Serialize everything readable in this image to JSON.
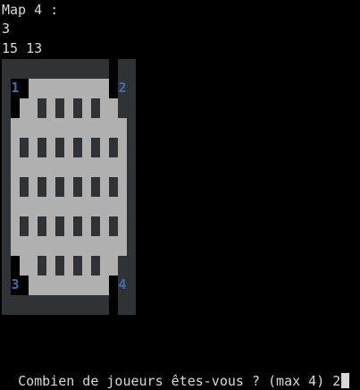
{
  "terminal": {
    "map_heading": "Map 4 :",
    "player_count_line": "3",
    "dimensions_line": "15 13",
    "prompt": "Combien de joueurs êtes-vous ? (max 4) 2"
  },
  "map": {
    "rows": 15,
    "cols": 13,
    "legend": {
      "#": "wall",
      ".": "floor",
      "X": "pillar",
      " ": "void",
      "1": "spawn",
      "2": "spawn",
      "3": "spawn",
      "4": "spawn"
    },
    "grid": [
      "############ #",
      "# ......... #",
      "1 .........2 ",
      "  .X.X.X.X.  ",
      " .........   ",
      " .X.X.X.X.X. ",
      " .........   ",
      " .X.X.X.X.X. ",
      " .........   ",
      " .X.X.X.X.X. ",
      "  .........  ",
      "  .X.X.X.X.  ",
      "3 .........4 ",
      "# ......... #",
      "############ #"
    ],
    "spawns": [
      {
        "label": "1",
        "color": "#3d6fb0"
      },
      {
        "label": "2",
        "color": "#3d6fb0"
      },
      {
        "label": "3",
        "color": "#3d6fb0"
      },
      {
        "label": "4",
        "color": "#3d6fb0"
      }
    ]
  },
  "colors": {
    "background": "#000000",
    "text": "#d9d9d9",
    "wall": "#2f3336",
    "floor": "#b0b0b0",
    "pillar": "#2f3336",
    "spawn_label": "#3d6fb0"
  }
}
